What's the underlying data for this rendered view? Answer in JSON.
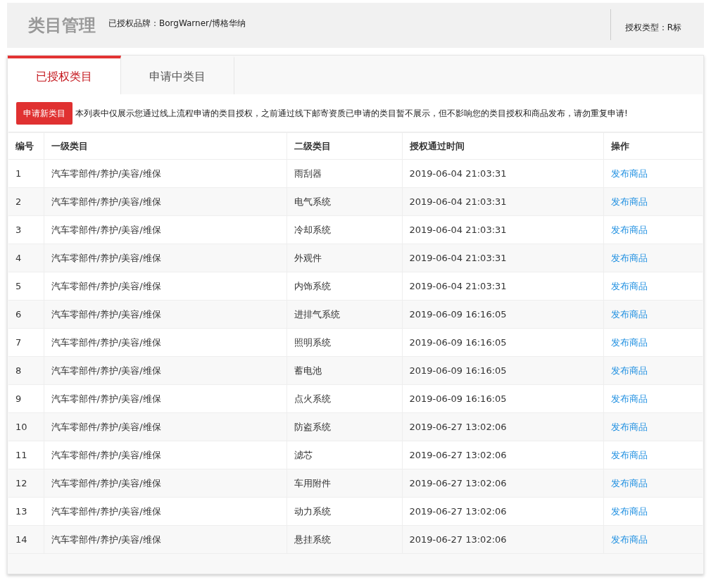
{
  "header": {
    "title": "类目管理",
    "brand": "已授权品牌：BorgWarner/博格华纳",
    "auth_type": "授权类型：R标"
  },
  "tabs": [
    {
      "label": "已授权类目",
      "selected": true
    },
    {
      "label": "申请中类目",
      "selected": false
    }
  ],
  "apply_button": "申请新类目",
  "notice": "本列表中仅展示您通过线上流程申请的类目授权，之前通过线下邮寄资质已申请的类目暂不展示，但不影响您的类目授权和商品发布，请勿重复申请!",
  "table": {
    "columns": [
      "编号",
      "一级类目",
      "二级类目",
      "授权通过时间",
      "操作"
    ],
    "rows": [
      [
        "1",
        "汽车零部件/养护/美容/维保",
        "雨刮器",
        "2019-06-04 21:03:31",
        "发布商品"
      ],
      [
        "2",
        "汽车零部件/养护/美容/维保",
        "电气系统",
        "2019-06-04 21:03:31",
        "发布商品"
      ],
      [
        "3",
        "汽车零部件/养护/美容/维保",
        "冷却系统",
        "2019-06-04 21:03:31",
        "发布商品"
      ],
      [
        "4",
        "汽车零部件/养护/美容/维保",
        "外观件",
        "2019-06-04 21:03:31",
        "发布商品"
      ],
      [
        "5",
        "汽车零部件/养护/美容/维保",
        "内饰系统",
        "2019-06-04 21:03:31",
        "发布商品"
      ],
      [
        "6",
        "汽车零部件/养护/美容/维保",
        "进排气系统",
        "2019-06-09 16:16:05",
        "发布商品"
      ],
      [
        "7",
        "汽车零部件/养护/美容/维保",
        "照明系统",
        "2019-06-09 16:16:05",
        "发布商品"
      ],
      [
        "8",
        "汽车零部件/养护/美容/维保",
        "蓄电池",
        "2019-06-09 16:16:05",
        "发布商品"
      ],
      [
        "9",
        "汽车零部件/养护/美容/维保",
        "点火系统",
        "2019-06-09 16:16:05",
        "发布商品"
      ],
      [
        "10",
        "汽车零部件/养护/美容/维保",
        "防盗系统",
        "2019-06-27 13:02:06",
        "发布商品"
      ],
      [
        "11",
        "汽车零部件/养护/美容/维保",
        "滤芯",
        "2019-06-27 13:02:06",
        "发布商品"
      ],
      [
        "12",
        "汽车零部件/养护/美容/维保",
        "车用附件",
        "2019-06-27 13:02:06",
        "发布商品"
      ],
      [
        "13",
        "汽车零部件/养护/美容/维保",
        "动力系统",
        "2019-06-27 13:02:06",
        "发布商品"
      ],
      [
        "14",
        "汽车零部件/养护/美容/维保",
        "悬挂系统",
        "2019-06-27 13:02:06",
        "发布商品"
      ]
    ]
  }
}
